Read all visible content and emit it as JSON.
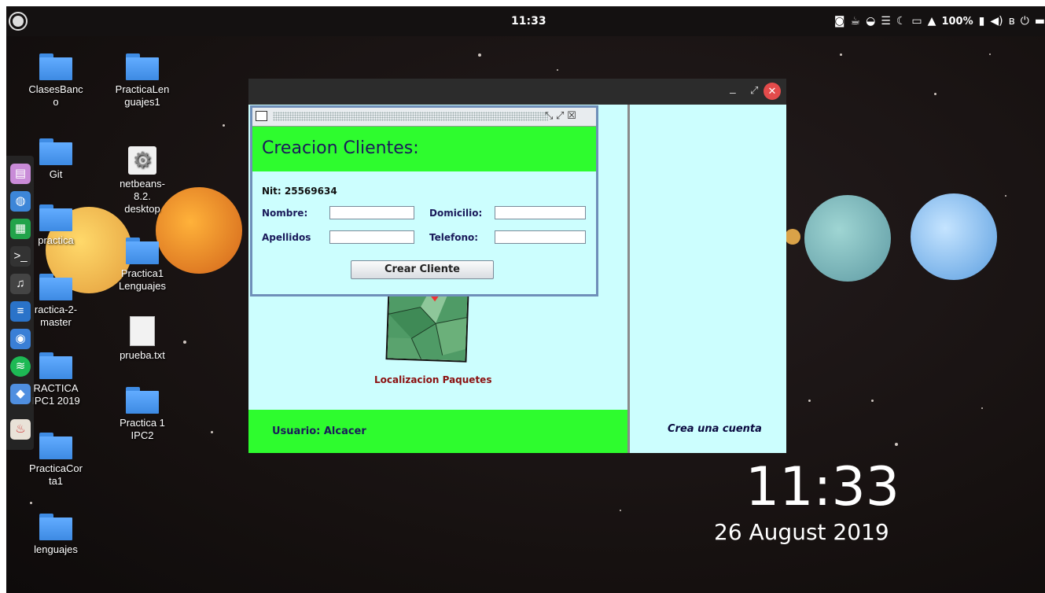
{
  "panel": {
    "clock": "11:33",
    "battery": "100%"
  },
  "desktop_icons": [
    {
      "label": "ClasesBanco",
      "line1": "ClasesBanc",
      "line2": "o"
    },
    {
      "label": "PracticaLenguajes1",
      "line1": "PracticaLen",
      "line2": "guajes1"
    },
    {
      "label": "Git"
    },
    {
      "label": "netbeans-8.2.desktop",
      "line1": "netbeans-",
      "line2": "8.2.",
      "line3": "desktop"
    },
    {
      "label": "practica"
    },
    {
      "label": "Practica1 Lenguajes",
      "line1": "Practica1",
      "line2": "Lenguajes"
    },
    {
      "label": "practica-2-master",
      "line1": "ractica-2-",
      "line2": "master"
    },
    {
      "label": "prueba.txt"
    },
    {
      "label": "PRACTICA IPC1 2019",
      "line1": "RACTICA",
      "line2": "IPC1 2019"
    },
    {
      "label": "Practica 1 IPC2",
      "line1": "Practica 1",
      "line2": "IPC2"
    },
    {
      "label": "PracticaCorta1",
      "line1": "PracticaCor",
      "line2": "ta1"
    },
    {
      "label": "lenguajes"
    }
  ],
  "app": {
    "user_label": "Usuario: Alcacer",
    "map_caption": "Localizacion Paquetes",
    "signup_link": "Crea una cuenta"
  },
  "dialog": {
    "heading": "Creacion Clientes:",
    "nit_label": "Nit: 25569634",
    "nombre_label": "Nombre:",
    "domicilio_label": "Domicilio:",
    "apellidos_label": "Apellidos",
    "telefono_label": "Telefono:",
    "nombre_value": "",
    "domicilio_value": "",
    "apellidos_value": "",
    "telefono_value": "",
    "create_button": "Crear Cliente"
  },
  "clock_widget": {
    "time": "11:33",
    "date": "26 August 2019"
  }
}
